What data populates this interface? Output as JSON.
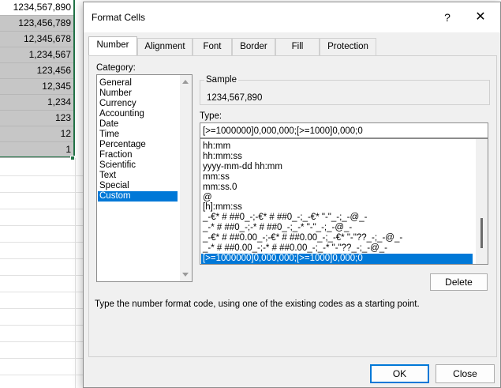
{
  "sheet": {
    "cells": [
      "1234,567,890",
      "123,456,789",
      "12,345,678",
      "1,234,567",
      "123,456",
      "12,345",
      "1,234",
      "123",
      "12",
      "1"
    ]
  },
  "dialog": {
    "title": "Format Cells",
    "help_icon": "?",
    "close_icon": "✕",
    "tabs": [
      "Number",
      "Alignment",
      "Font",
      "Border",
      "Fill",
      "Protection"
    ],
    "category_label": "Category:",
    "categories": [
      "General",
      "Number",
      "Currency",
      "Accounting",
      "Date",
      "Time",
      "Percentage",
      "Fraction",
      "Scientific",
      "Text",
      "Special",
      "Custom"
    ],
    "selected_category": "Custom",
    "sample_label": "Sample",
    "sample_value": "1234,567,890",
    "type_label": "Type:",
    "type_value": "[>=1000000]0,000,000;[>=1000]0,000;0",
    "type_list": [
      "hh:mm",
      "hh:mm:ss",
      "yyyy-mm-dd hh:mm",
      "mm:ss",
      "mm:ss.0",
      "@",
      "[h]:mm:ss",
      "_-€* # ##0_-;-€* # ##0_-;_-€* \"-\"_-;_-@_-",
      "_-* # ##0_-;-* # ##0_-;_-* \"-\"_-;_-@_-",
      "_-€* # ##0.00_-;-€* # ##0.00_-;_-€* \"-\"??_-;_-@_-",
      "_-* # ##0.00_-;-* # ##0.00_-;_-* \"-\"??_-;_-@_-",
      "[>=1000000]0,000,000;[>=1000]0,000;0"
    ],
    "delete_label": "Delete",
    "hint": "Type the number format code, using one of the existing codes as a starting point.",
    "ok_label": "OK",
    "close_label": "Close"
  },
  "colors": {
    "selection": "#0078d7",
    "sheet_selection": "#217346"
  }
}
